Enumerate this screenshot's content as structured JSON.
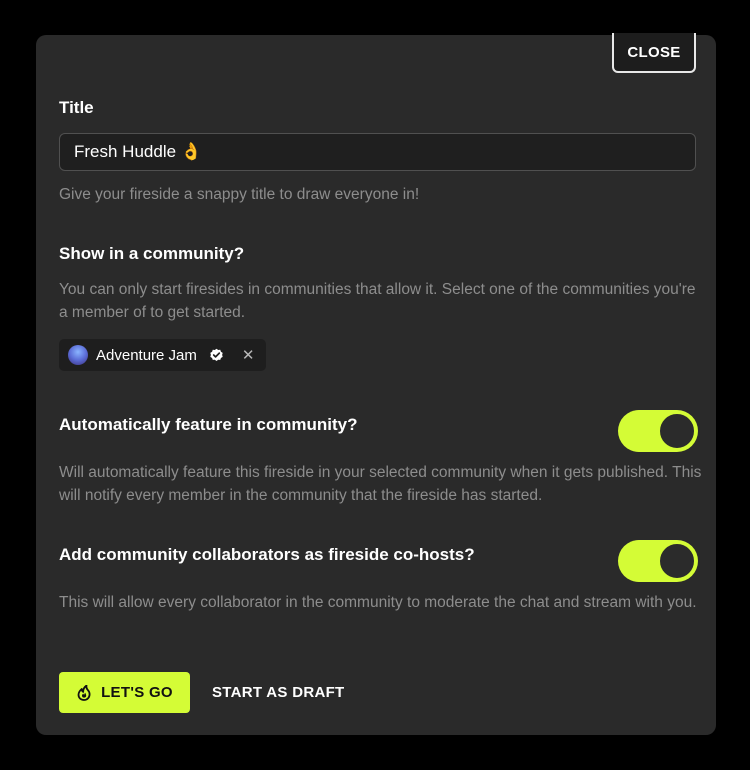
{
  "close_label": "CLOSE",
  "title_section": {
    "heading": "Title",
    "input_value": "Fresh Huddle 👌",
    "help": "Give your fireside a snappy title to draw everyone in!"
  },
  "community_section": {
    "heading": "Show in a community?",
    "help": "You can only start firesides in communities that allow it. Select one of the communities you're a member of to get started.",
    "chip": {
      "name": "Adventure Jam",
      "avatar_icon": "community-avatar-icon",
      "verified_icon": "verified-icon",
      "remove_icon": "close-icon"
    }
  },
  "feature_section": {
    "heading": "Automatically feature in community?",
    "help": "Will automatically feature this fireside in your selected community when it gets published. This will notify every member in the community that the fireside has started.",
    "toggle_on": true
  },
  "cohost_section": {
    "heading": "Add community collaborators as fireside co-hosts?",
    "help": "This will allow every collaborator in the community to moderate the chat and stream with you.",
    "toggle_on": true
  },
  "actions": {
    "primary_label": "LET'S GO",
    "primary_icon": "fireside-icon",
    "secondary_label": "START AS DRAFT"
  },
  "colors": {
    "accent": "#d4fc36",
    "panel": "#2a2a2a",
    "background": "#000000"
  }
}
